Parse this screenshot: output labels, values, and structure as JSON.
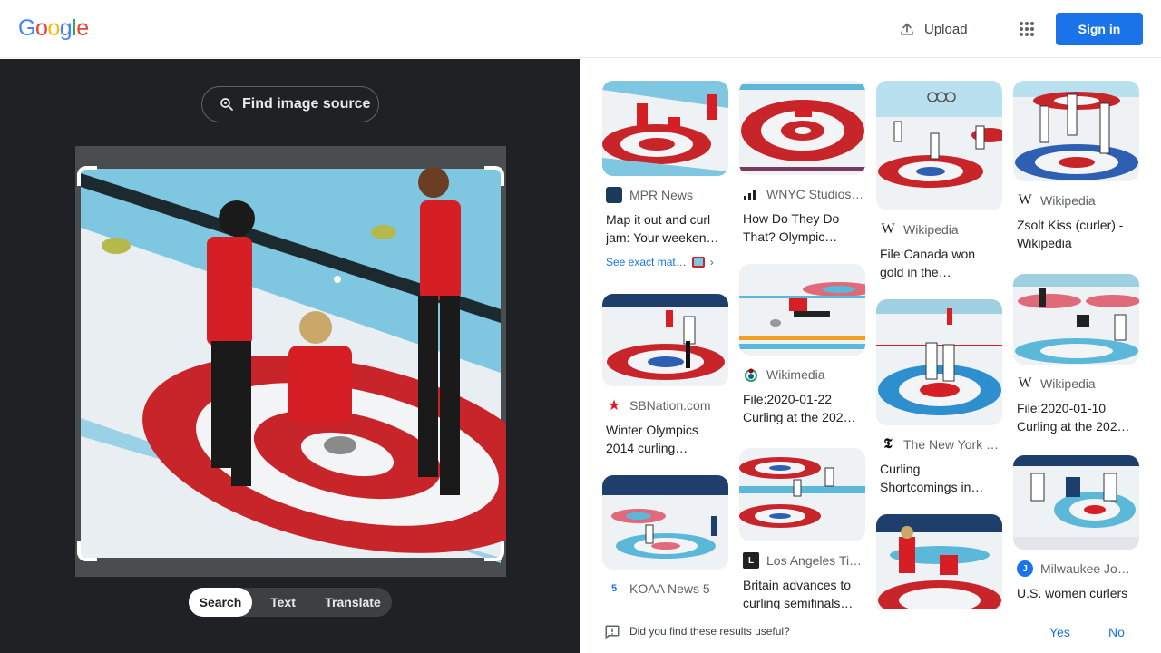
{
  "header": {
    "logo_letters": [
      {
        "ch": "G",
        "color": "#4285F4"
      },
      {
        "ch": "o",
        "color": "#EA4335"
      },
      {
        "ch": "o",
        "color": "#FBBC05"
      },
      {
        "ch": "g",
        "color": "#4285F4"
      },
      {
        "ch": "l",
        "color": "#34A853"
      },
      {
        "ch": "e",
        "color": "#EA4335"
      }
    ],
    "upload_label": "Upload",
    "upload_icon": "upload-icon",
    "apps_icon": "apps-grid-icon",
    "signin_label": "Sign in",
    "accent": "#1a73e8"
  },
  "left_panel": {
    "find_source_label": "Find image source",
    "find_source_icon": "lens-search-icon",
    "tabs": [
      {
        "label": "Search",
        "active": true
      },
      {
        "label": "Text",
        "active": false
      },
      {
        "label": "Translate",
        "active": false
      }
    ]
  },
  "results": {
    "col1": [
      {
        "source": "MPR News",
        "favicon": "mpr-news-favicon",
        "title": "Map it out and curl jam: Your weeken…",
        "exact": "See exact mat…"
      },
      {
        "source": "SBNation.com",
        "favicon": "sbnation-star-favicon",
        "title": "Winter Olympics 2014 curling…"
      },
      {
        "source": "KOAA News 5",
        "favicon": "koaa-favicon",
        "title": ""
      }
    ],
    "col2": [
      {
        "source": "WNYC Studios…",
        "favicon": "wnyc-bars-favicon",
        "title": "How Do They Do That? Olympic…"
      },
      {
        "source": "Wikimedia",
        "favicon": "wikimedia-favicon",
        "title": "File:2020-01-22 Curling at the 202…"
      },
      {
        "source": "Los Angeles Ti…",
        "favicon": "la-times-favicon",
        "title": "Britain advances to curling semifinals…"
      }
    ],
    "col3": [
      {
        "source": "Wikipedia",
        "favicon": "wikipedia-w-favicon",
        "title": "File:Canada won gold in the…"
      },
      {
        "source": "The New York …",
        "favicon": "nyt-favicon",
        "title": "Curling Shortcomings in…"
      },
      {
        "source": "",
        "favicon": "",
        "title": ""
      }
    ],
    "col4": [
      {
        "source": "Wikipedia",
        "favicon": "wikipedia-w-favicon",
        "title": "Zsolt Kiss (curler) - Wikipedia"
      },
      {
        "source": "Wikipedia",
        "favicon": "wikipedia-w-favicon",
        "title": "File:2020-01-10 Curling at the 202…"
      },
      {
        "source": "Milwaukee Jo…",
        "favicon": "milwaukee-journal-favicon",
        "title": "U.S. women curlers"
      }
    ]
  },
  "feedback": {
    "question": "Did you find these results useful?",
    "yes": "Yes",
    "no": "No"
  }
}
